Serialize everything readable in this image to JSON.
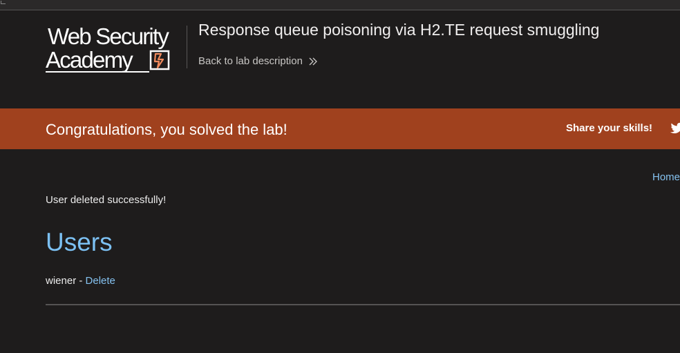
{
  "header": {
    "logo": {
      "line1": "Web Security",
      "line2": "Academy",
      "bolt_icon": "lightning-bolt-icon"
    },
    "lab_title": "Response queue poisoning via H2.TE request smuggling",
    "back_link": "Back to lab description",
    "back_icon": "double-chevron-right-icon"
  },
  "banner": {
    "message": "Congratulations, you solved the lab!",
    "share_label": "Share your skills!",
    "share_icon": "twitter-icon",
    "color": "#a0411e"
  },
  "nav": {
    "home_link": "Home"
  },
  "content": {
    "status_message": "User deleted successfully!",
    "heading": "Users",
    "users": [
      {
        "name": "wiener",
        "separator": " - ",
        "action": "Delete"
      }
    ]
  },
  "colors": {
    "background": "#1e1c1c",
    "link": "#85c2f0",
    "accent": "#a0411e"
  }
}
